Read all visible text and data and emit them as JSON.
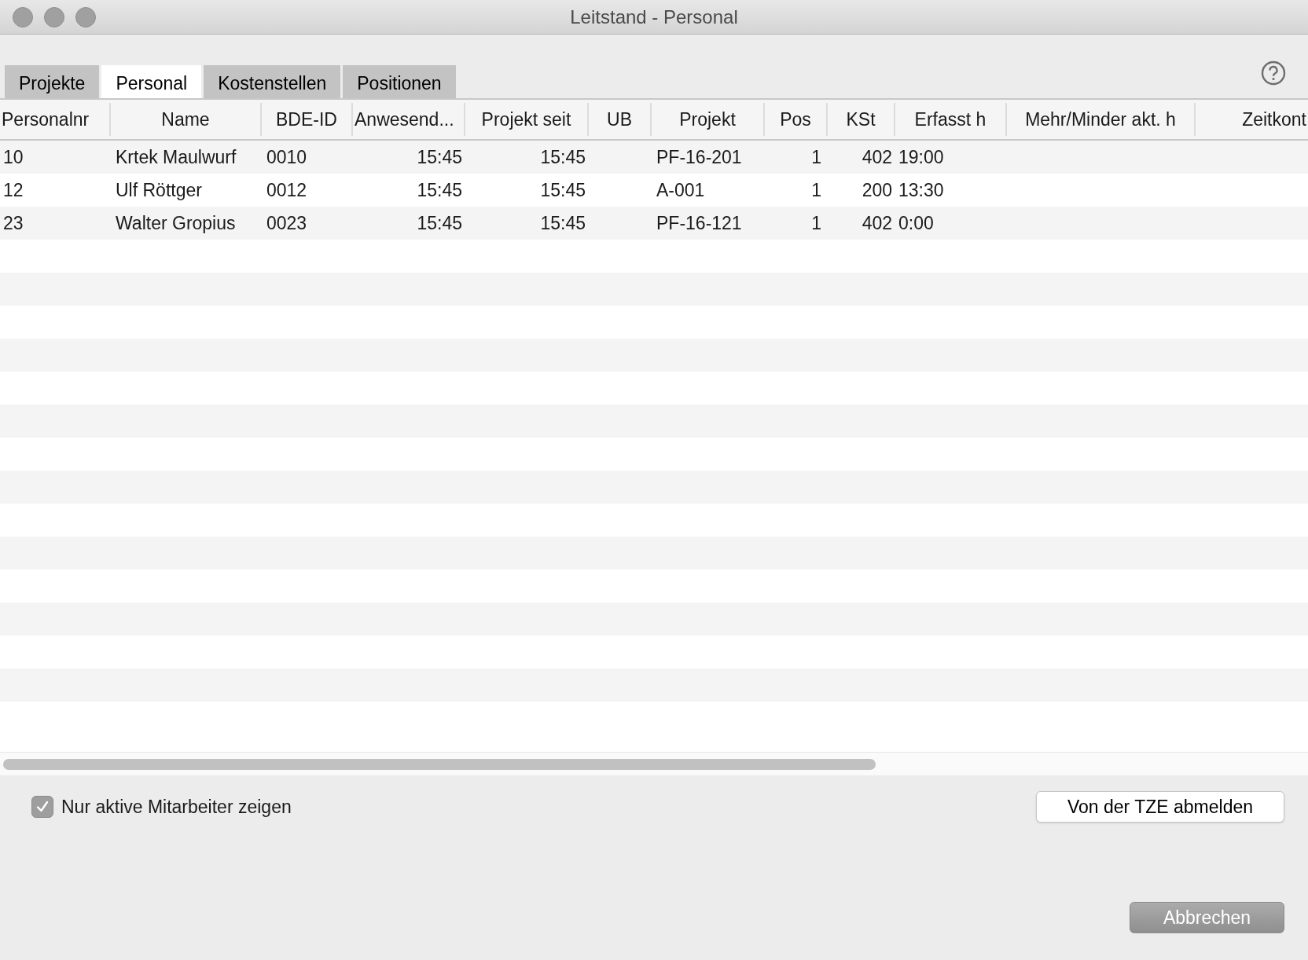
{
  "window": {
    "title": "Leitstand - Personal"
  },
  "tabs": [
    {
      "label": "Projekte",
      "selected": false
    },
    {
      "label": "Personal",
      "selected": true
    },
    {
      "label": "Kostenstellen",
      "selected": false
    },
    {
      "label": "Positionen",
      "selected": false
    }
  ],
  "table": {
    "columns": [
      "Personalnr",
      "Name",
      "BDE-ID",
      "Anwesend...",
      "Projekt seit",
      "UB",
      "Projekt",
      "Pos",
      "KSt",
      "Erfasst h",
      "Mehr/Minder akt. h",
      "Zeitkont"
    ],
    "rows": [
      {
        "cells": [
          "10",
          "Krtek Maulwurf",
          "0010",
          "15:45",
          "15:45",
          "",
          "PF-16-201",
          "1",
          "402",
          "19:00",
          "",
          ""
        ]
      },
      {
        "cells": [
          "12",
          "Ulf Röttger",
          "0012",
          "15:45",
          "15:45",
          "",
          "A-001",
          "1",
          "200",
          "13:30",
          "",
          ""
        ]
      },
      {
        "cells": [
          "23",
          "Walter Gropius",
          "0023",
          "15:45",
          "15:45",
          "",
          "PF-16-121",
          "1",
          "402",
          "0:00",
          "",
          ""
        ]
      }
    ]
  },
  "filter": {
    "label": "Nur aktive Mitarbeiter zeigen",
    "checked": true
  },
  "buttons": [
    {
      "label": "Von der TZE abmelden",
      "kind": "default"
    },
    {
      "label": "Abbrechen",
      "kind": "cancel"
    }
  ]
}
